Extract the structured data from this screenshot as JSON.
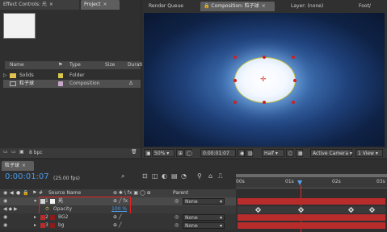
{
  "effect_controls": {
    "tab_label": "Effect Controls: 光",
    "project_tab": "Project"
  },
  "project": {
    "columns": [
      "Name",
      "Type",
      "Size",
      "Durati"
    ],
    "items": [
      {
        "name": "Solids",
        "type": "Folder"
      },
      {
        "name": "粒子球",
        "type": "Composition",
        "size": "Δ"
      }
    ],
    "bpc": "8 bpc"
  },
  "viewer": {
    "tabs": [
      "Render Queue",
      "Composition: 粒子球",
      "Layer: (none)",
      "Foot/"
    ],
    "zoom": "50%",
    "timecode": "0:00:01:07",
    "resolution": "Half",
    "camera": "Active Camera",
    "views": "1 View"
  },
  "timeline": {
    "tab_label": "粒子球",
    "timecode": "0:00:01:07",
    "fps": "(25.00 fps)",
    "column_source": "Source Name",
    "column_parent": "Parent",
    "ruler": [
      "00s",
      "01s",
      "02s",
      "03s"
    ],
    "layers": [
      {
        "num": "1",
        "name": "光",
        "color": "#d8d8d8",
        "parent": "None"
      },
      {
        "name": "Opacity",
        "value": "100 %"
      },
      {
        "num": "2",
        "name": "BG2",
        "color": "#8a1c1c",
        "parent": "None"
      },
      {
        "num": "3",
        "name": "bg",
        "color": "#8a1c1c",
        "parent": "None"
      }
    ]
  },
  "colors": {
    "accent_blue": "#3a86d8",
    "layer_bar": "#b82c2c",
    "highlight_box": "#e22222"
  }
}
